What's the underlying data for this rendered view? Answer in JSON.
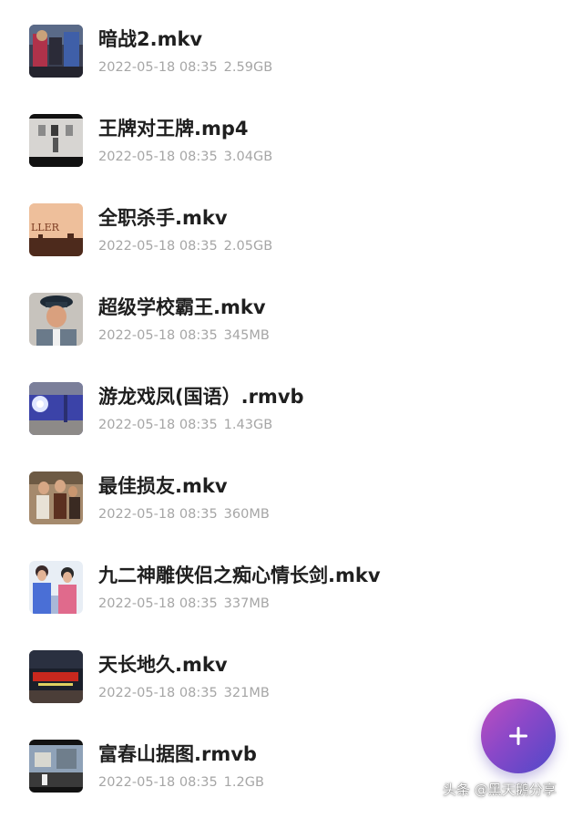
{
  "files": [
    {
      "name": "暗战2.mkv",
      "date": "2022-05-18 08:35",
      "size": "2.59GB",
      "thumb_icon": "video-thumbnail"
    },
    {
      "name": "王牌对王牌.mp4",
      "date": "2022-05-18 08:35",
      "size": "3.04GB",
      "thumb_icon": "video-thumbnail"
    },
    {
      "name": "全职杀手.mkv",
      "date": "2022-05-18 08:35",
      "size": "2.05GB",
      "thumb_icon": "video-thumbnail",
      "thumb_text": "LLER"
    },
    {
      "name": "超级学校霸王.mkv",
      "date": "2022-05-18 08:35",
      "size": "345MB",
      "thumb_icon": "video-thumbnail"
    },
    {
      "name": "游龙戏凤(国语）.rmvb",
      "date": "2022-05-18 08:35",
      "size": "1.43GB",
      "thumb_icon": "video-thumbnail"
    },
    {
      "name": "最佳损友.mkv",
      "date": "2022-05-18 08:35",
      "size": "360MB",
      "thumb_icon": "video-thumbnail"
    },
    {
      "name": "九二神雕侠侣之痴心情长剑.mkv",
      "date": "2022-05-18 08:35",
      "size": "337MB",
      "thumb_icon": "video-thumbnail"
    },
    {
      "name": "天长地久.mkv",
      "date": "2022-05-18 08:35",
      "size": "321MB",
      "thumb_icon": "video-thumbnail"
    },
    {
      "name": "富春山据图.rmvb",
      "date": "2022-05-18 08:35",
      "size": "1.2GB",
      "thumb_icon": "video-thumbnail"
    }
  ],
  "fab": {
    "icon": "plus-icon",
    "label": "+"
  },
  "watermark": {
    "text": "头条 @黑天鹅分享"
  },
  "colors": {
    "title": "#1f1f1f",
    "meta": "#a6a6a6",
    "fab_start": "#c04fbf",
    "fab_end": "#4f49c9"
  }
}
